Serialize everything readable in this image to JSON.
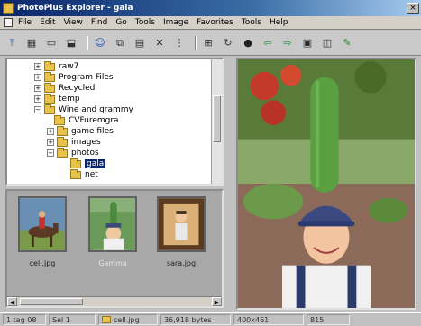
{
  "window": {
    "title": "PhotoPlus Explorer - gala"
  },
  "menus": [
    "File",
    "Edit",
    "View",
    "Find",
    "Go",
    "Tools",
    "Image",
    "Favorites",
    "Tools",
    "Help"
  ],
  "toolbar": {
    "icons": [
      "up-folder-icon",
      "copy-icon",
      "folder-icon",
      "move-icon",
      "person-icon",
      "copy-images-icon",
      "paste-icon",
      "delete-icon",
      "properties-icon",
      "zoom-icon",
      "rotate-icon",
      "light-bulb-icon",
      "back-arrow-icon",
      "forward-arrow-icon",
      "view-icon",
      "slideshow-icon",
      "edit-icon"
    ]
  },
  "tree": {
    "items": [
      {
        "label": "raw7",
        "indent": 2,
        "expander": "+"
      },
      {
        "label": "Program Files",
        "indent": 2,
        "expander": "+"
      },
      {
        "label": "Recycled",
        "indent": 2,
        "expander": "+"
      },
      {
        "label": "temp",
        "indent": 2,
        "expander": "+"
      },
      {
        "label": "Wine and grammy",
        "indent": 2,
        "expander": "-"
      },
      {
        "label": "CVFuremgra",
        "indent": 3,
        "expander": ""
      },
      {
        "label": "game files",
        "indent": 3,
        "expander": "+"
      },
      {
        "label": "images",
        "indent": 3,
        "expander": "+"
      },
      {
        "label": "photos",
        "indent": 3,
        "expander": "-"
      },
      {
        "label": "gala",
        "indent": 4,
        "expander": "",
        "selected": true
      },
      {
        "label": "net",
        "indent": 4,
        "expander": ""
      }
    ]
  },
  "thumbnails": [
    {
      "caption": "cell.jpg",
      "image": "person-on-horse",
      "selected": false
    },
    {
      "caption": "Gamma",
      "image": "person-with-cactus",
      "selected": true
    },
    {
      "caption": "sara.jpg",
      "image": "person-portrait",
      "selected": false
    }
  ],
  "preview": {
    "image": "person-in-cap-with-cactus"
  },
  "status": {
    "count": "1 tag 08",
    "selected": "Sel 1",
    "filename": "cell.jpg",
    "size": "36,918 bytes",
    "dimensions": "400x461",
    "extra": "815"
  }
}
